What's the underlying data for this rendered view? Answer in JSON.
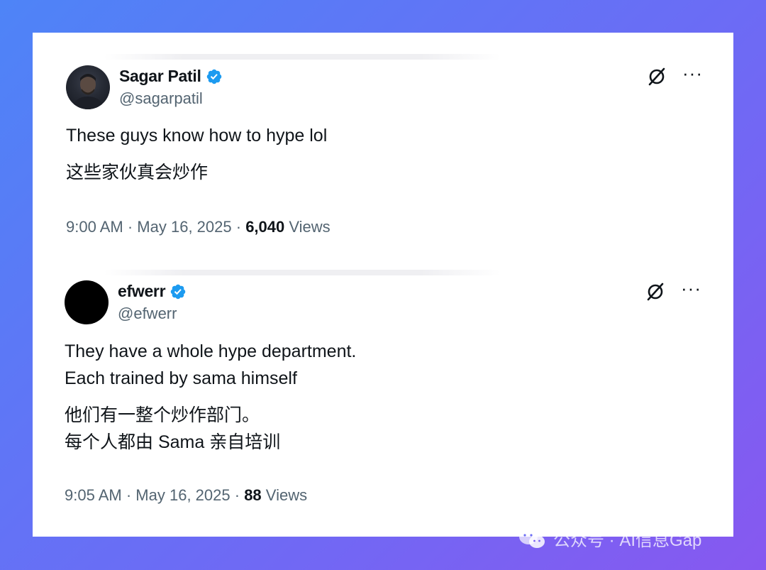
{
  "tweets": [
    {
      "display_name": "Sagar Patil",
      "handle": "@sagarpatil",
      "text_en": "These guys know how to hype lol",
      "text_zh": "这些家伙真会炒作",
      "time": "9:00 AM",
      "date": "May 16, 2025",
      "views_count": "6,040",
      "views_label": "Views",
      "separator": "·"
    },
    {
      "display_name": "efwerr",
      "handle": "@efwerr",
      "text_en": "They have a whole hype department.\nEach trained by sama himself",
      "text_zh": "他们有一整个炒作部门。\n每个人都由 Sama 亲自培训",
      "time": "9:05 AM",
      "date": "May 16, 2025",
      "views_count": "88",
      "views_label": "Views",
      "separator": "·"
    }
  ],
  "icons": {
    "verified": "verified-badge-icon",
    "grok": "grok-icon",
    "more": "more-options-icon",
    "wechat": "wechat-icon"
  },
  "more_glyph": "···",
  "watermark": {
    "text": "公众号 · AI信息Gap"
  },
  "colors": {
    "background_start": "#4e84f7",
    "background_end": "#8758f0",
    "verified": "#1d9bf0",
    "text_primary": "#0f1419",
    "text_secondary": "#536471"
  }
}
